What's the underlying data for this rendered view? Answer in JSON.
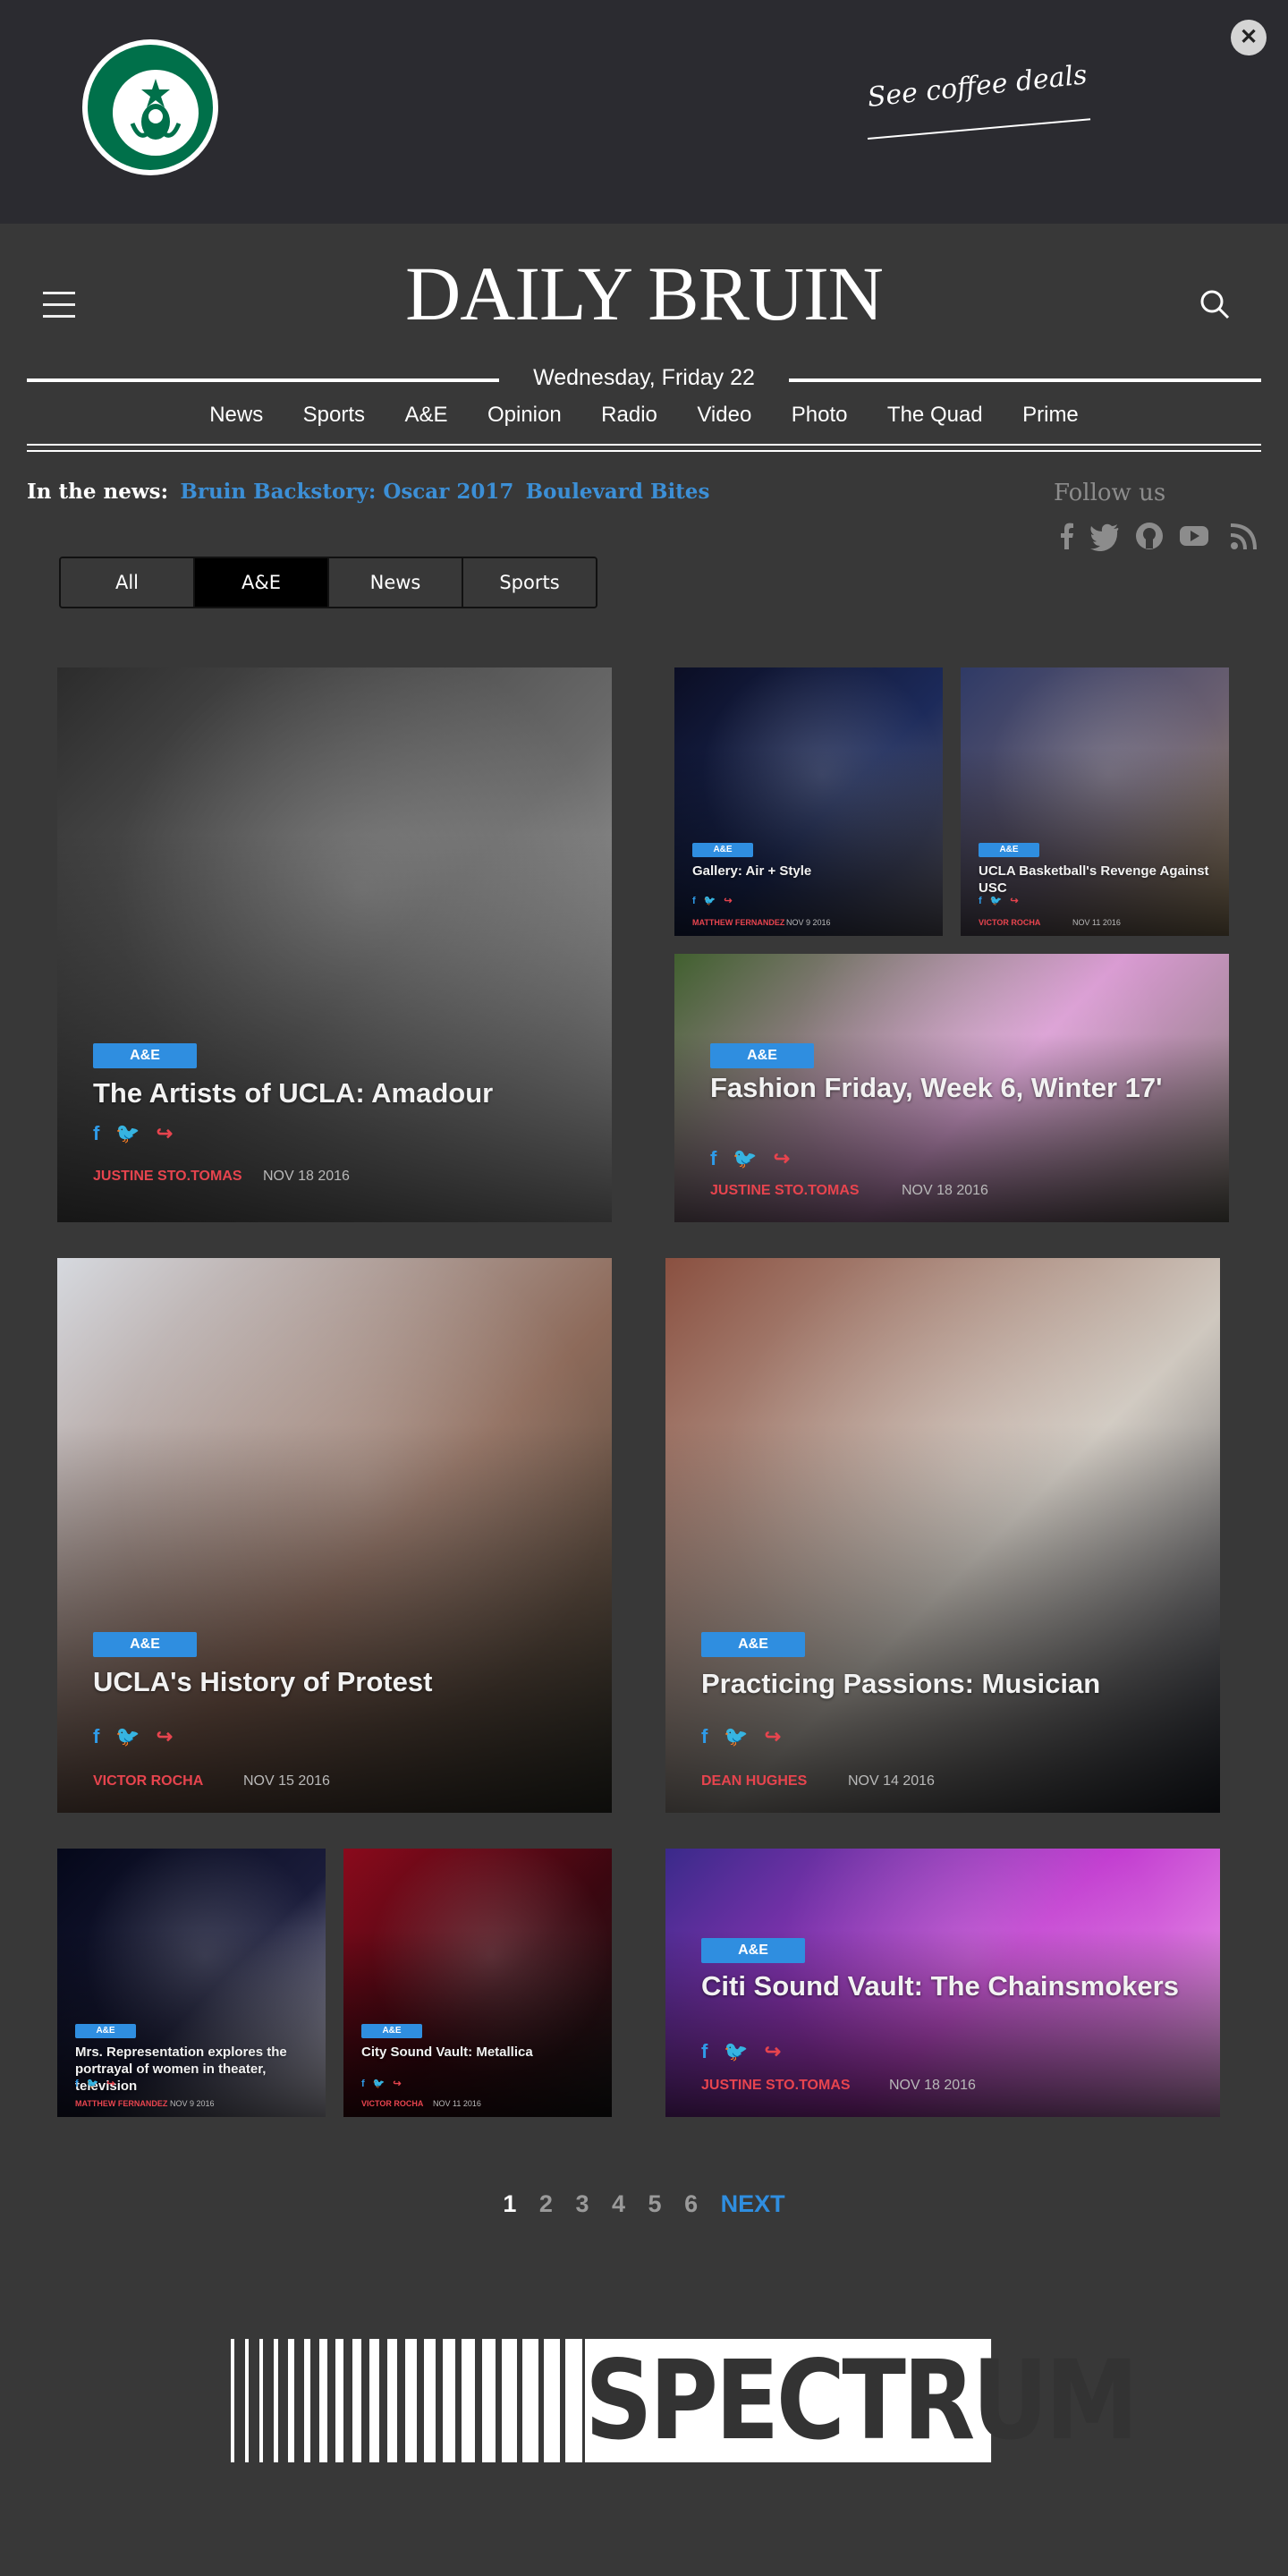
{
  "ad": {
    "cta": "See coffee deals",
    "close": "✕"
  },
  "header": {
    "brand": "DAILY BRUIN",
    "date": "Wednesday, Friday 22",
    "nav": [
      "News",
      "Sports",
      "A&E",
      "Opinion",
      "Radio",
      "Video",
      "Photo",
      "The Quad",
      "Prime"
    ]
  },
  "in_the_news": {
    "label": "In the news:",
    "links": [
      "Bruin Backstory: Oscar 2017",
      "Boulevard Bites"
    ]
  },
  "follow": {
    "label": "Follow us",
    "icons": [
      "facebook-icon",
      "twitter-icon",
      "github-icon",
      "youtube-icon",
      "rss-icon"
    ]
  },
  "filters": {
    "tabs": [
      "All",
      "A&E",
      "News",
      "Sports"
    ],
    "active": "A&E"
  },
  "share_icons": [
    "f",
    "🐦",
    "↪"
  ],
  "articles": [
    {
      "tag": "A&E",
      "title": "The Artists of UCLA: Amadour",
      "author": "JUSTINE STO.TOMAS",
      "date": "NOV 18 2016",
      "colors": [
        "#2c2c2c",
        "#6a6a6a",
        "#c8c8c8"
      ]
    },
    {
      "tag": "A&E",
      "title": "Gallery: Air + Style",
      "author": "MATTHEW FERNANDEZ",
      "date": "NOV 9 2016",
      "colors": [
        "#0b0e24",
        "#1c2a5a",
        "#6c6a78"
      ]
    },
    {
      "tag": "A&E",
      "title": "UCLA Basketball's Revenge Against USC",
      "author": "VICTOR ROCHA",
      "date": "NOV 11 2016",
      "colors": [
        "#2f3a66",
        "#6a5f70",
        "#a58f6a"
      ]
    },
    {
      "tag": "A&E",
      "title": "Fashion Friday, Week 6, Winter 17'",
      "author": "JUSTINE STO.TOMAS",
      "date": "NOV 18 2016",
      "colors": [
        "#41602f",
        "#d99ad2",
        "#7c7a6e"
      ]
    },
    {
      "tag": "A&E",
      "title": "UCLA's History of Protest",
      "author": "VICTOR ROCHA",
      "date": "NOV 15 2016",
      "colors": [
        "#d6d9df",
        "#8d6a5a",
        "#3a3a30"
      ]
    },
    {
      "tag": "A&E",
      "title": "Practicing Passions: Musician",
      "author": "DEAN HUGHES",
      "date": "NOV 14 2016",
      "colors": [
        "#8a5040",
        "#cfc8bf",
        "#262b36"
      ]
    },
    {
      "tag": "A&E",
      "title": "Mrs. Representation explores the portrayal of women in theater, television",
      "author": "MATTHEW FERNANDEZ",
      "date": "NOV 9 2016",
      "colors": [
        "#05081a",
        "#1a1c3a",
        "#d8d6e4"
      ]
    },
    {
      "tag": "A&E",
      "title": "City Sound Vault: Metallica",
      "author": "VICTOR ROCHA",
      "date": "NOV 11 2016",
      "colors": [
        "#8a0a1c",
        "#3a0710",
        "#1a1a1a"
      ]
    },
    {
      "tag": "A&E",
      "title": "Citi Sound Vault: The Chainsmokers",
      "author": "JUSTINE STO.TOMAS",
      "date": "NOV 18 2016",
      "colors": [
        "#3a2a8a",
        "#c23bd0",
        "#f6b0f0"
      ]
    }
  ],
  "pager": {
    "pages": [
      "1",
      "2",
      "3",
      "4",
      "5",
      "6"
    ],
    "current": "1",
    "next": "NEXT"
  },
  "footer": {
    "logo_text": "SPECTRUM"
  }
}
